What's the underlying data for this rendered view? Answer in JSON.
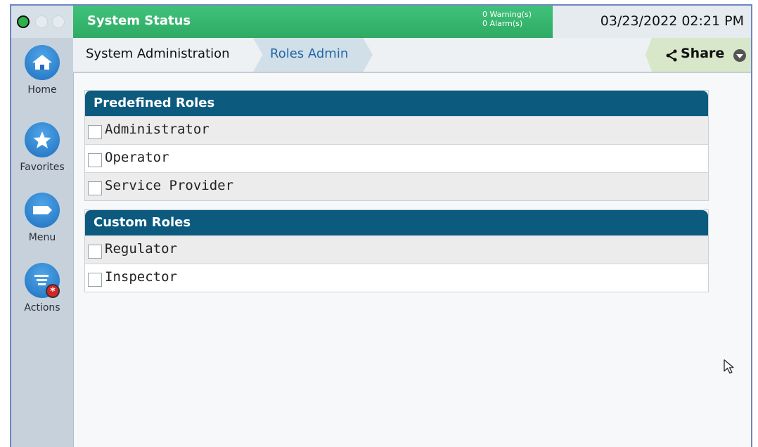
{
  "topbar": {
    "status_title": "System Status",
    "warnings": "0 Warning(s)",
    "alarms": "0 Alarm(s)",
    "datetime": "03/23/2022 02:21 PM"
  },
  "sidenav": {
    "items": [
      {
        "label": "Home",
        "icon": "home-icon"
      },
      {
        "label": "Favorites",
        "icon": "star-icon"
      },
      {
        "label": "Menu",
        "icon": "menu-tag-icon"
      },
      {
        "label": "Actions",
        "icon": "actions-list-icon"
      }
    ]
  },
  "breadcrumb": {
    "items": [
      "System Administration",
      "Roles Admin"
    ],
    "share_label": "Share"
  },
  "predefined": {
    "title": "Predefined Roles",
    "rows": [
      "Administrator",
      "Operator",
      "Service Provider"
    ]
  },
  "custom": {
    "title": "Custom Roles",
    "rows": [
      "Regulator",
      "Inspector"
    ]
  },
  "colors": {
    "status_green": "#2eaa63",
    "header_blue": "#0c5b7f",
    "nav_blue": "#1f6fbd"
  }
}
